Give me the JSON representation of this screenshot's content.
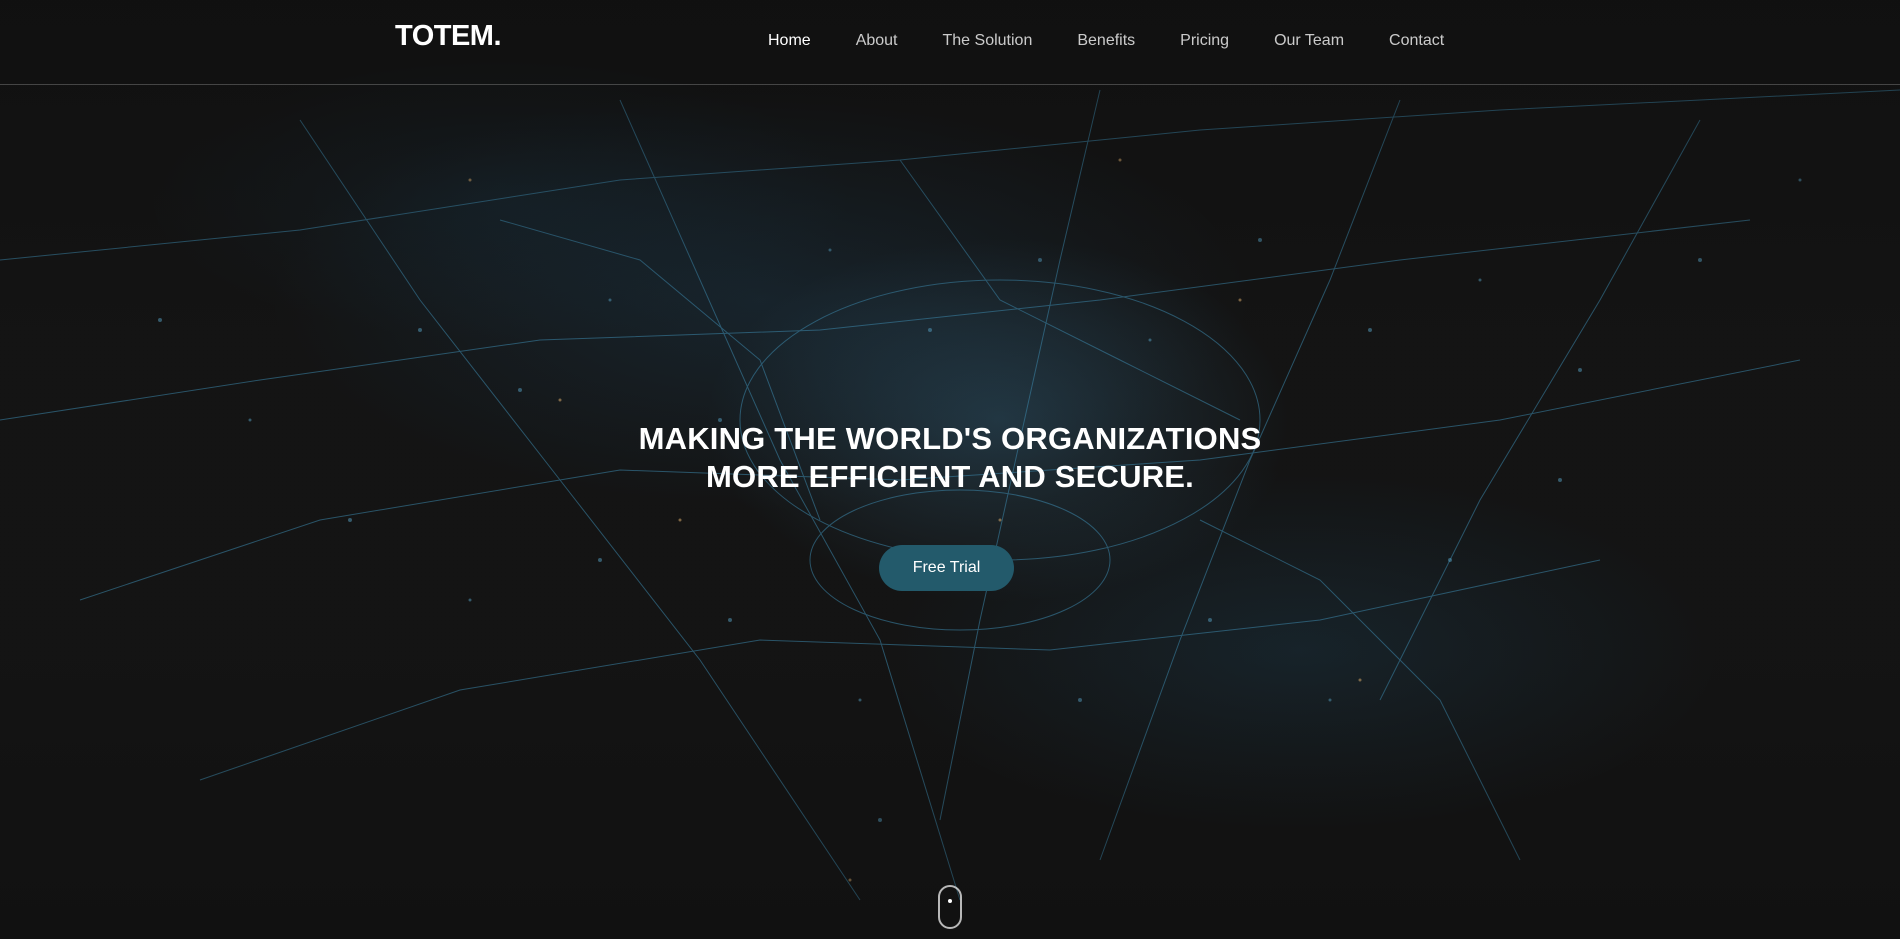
{
  "brand": {
    "logo_text": "TOTEM."
  },
  "nav": {
    "items": [
      {
        "label": "Home",
        "active": true
      },
      {
        "label": "About"
      },
      {
        "label": "The Solution"
      },
      {
        "label": "Benefits"
      },
      {
        "label": "Pricing"
      },
      {
        "label": "Our Team"
      },
      {
        "label": "Contact"
      }
    ]
  },
  "hero": {
    "headline_line1": "MAKING THE WORLD'S ORGANIZATIONS",
    "headline_line2": "MORE EFFICIENT AND SECURE.",
    "cta_label": "Free Trial",
    "background": "aerial-city-night-image",
    "scroll_icon": "mouse-scroll-icon"
  },
  "colors": {
    "background": "#141414",
    "cta": "#235a6b",
    "text": "#ffffff",
    "city_lights": "#3f8fb5"
  }
}
